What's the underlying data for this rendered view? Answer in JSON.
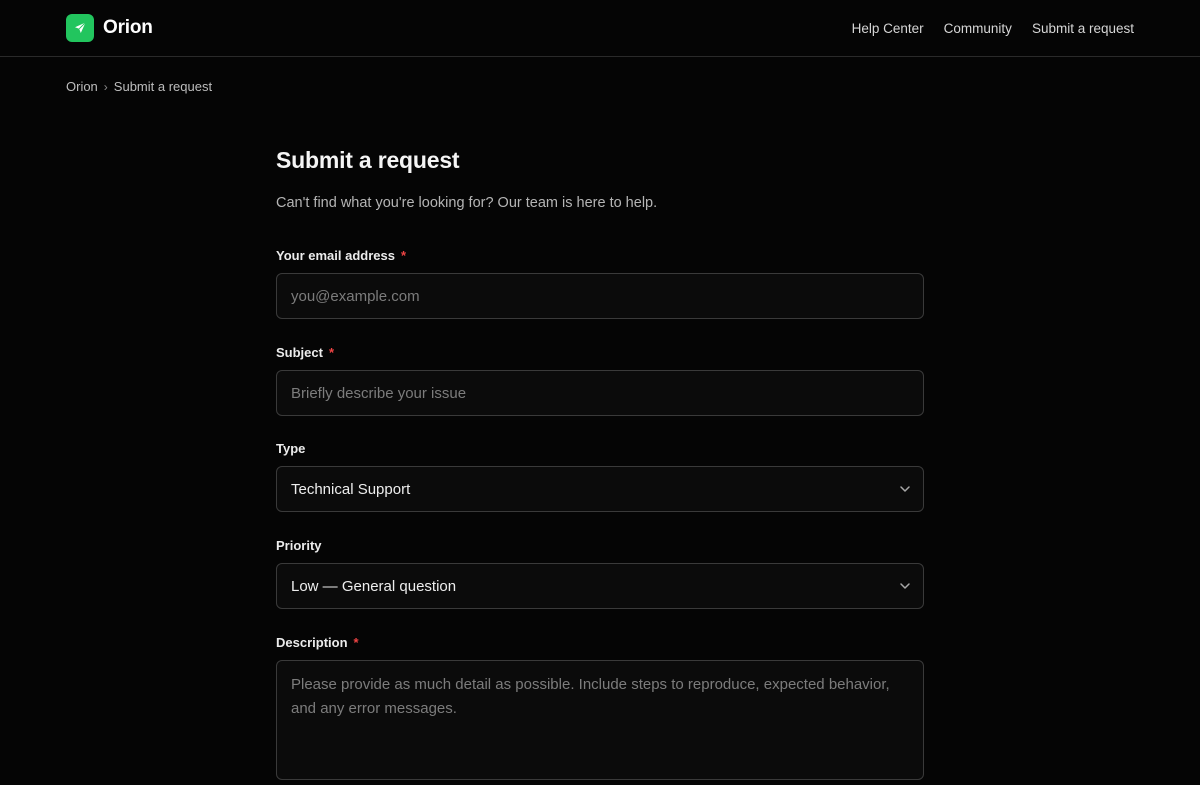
{
  "brand": {
    "name": "Orion",
    "accent": "#22c55e",
    "logo_icon": "rocket-icon"
  },
  "nav": {
    "items": [
      {
        "label": "Help Center"
      },
      {
        "label": "Community"
      },
      {
        "label": "Submit a request"
      }
    ]
  },
  "breadcrumb": {
    "items": [
      "Orion",
      "Submit a request"
    ],
    "separator": "›"
  },
  "page": {
    "title": "Submit a request",
    "subtitle": "Can't find what you're looking for? Our team is here to help."
  },
  "form": {
    "email": {
      "label": "Your email address",
      "required_mark": "*",
      "placeholder": "you@example.com",
      "value": ""
    },
    "subject": {
      "label": "Subject",
      "required_mark": "*",
      "placeholder": "Briefly describe your issue",
      "value": ""
    },
    "type": {
      "label": "Type",
      "selected": "Technical Support"
    },
    "priority": {
      "label": "Priority",
      "selected": "Low — General question"
    },
    "description": {
      "label": "Description",
      "required_mark": "*",
      "placeholder": "Please provide as much detail as possible. Include steps to reproduce, expected behavior, and any error messages.",
      "value": ""
    }
  },
  "colors": {
    "background": "#050505",
    "required": "#ef4444",
    "border": "#3a3a3a"
  }
}
